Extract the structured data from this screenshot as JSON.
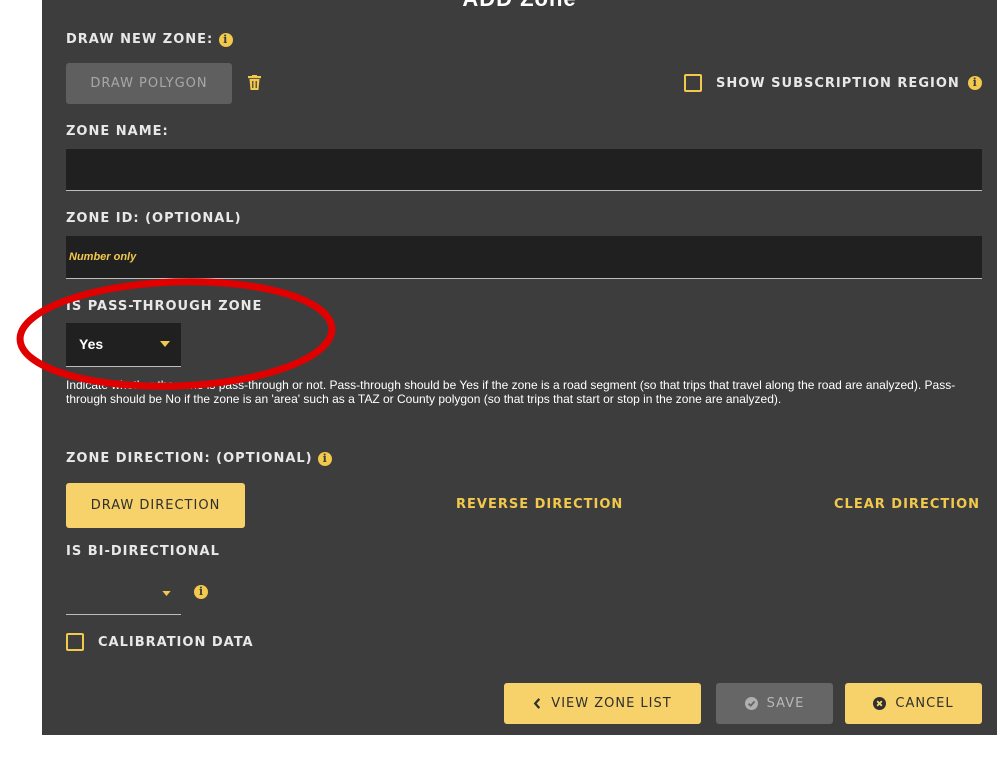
{
  "dialog": {
    "title": "ADD Zone"
  },
  "draw_zone": {
    "label": "DRAW NEW ZONE:",
    "draw_polygon_label": "DRAW POLYGON",
    "show_subscription_label": "SHOW SUBSCRIPTION REGION"
  },
  "zone_name": {
    "label": "ZONE NAME:",
    "value": ""
  },
  "zone_id": {
    "label": "ZONE ID: (OPTIONAL)",
    "placeholder": "Number only"
  },
  "pass_through": {
    "label": "IS PASS-THROUGH ZONE",
    "selected": "Yes",
    "help": "Indicate whether the zone is pass-through or not. Pass-through should be Yes if the zone is a road segment (so that trips that travel along the road are analyzed). Pass-through should be No if the zone is an 'area' such as a TAZ or County polygon (so that trips that start or stop in the zone are analyzed)."
  },
  "zone_direction": {
    "label": "ZONE DIRECTION: (OPTIONAL)",
    "draw_label": "DRAW DIRECTION",
    "reverse_label": "REVERSE DIRECTION",
    "clear_label": "CLEAR DIRECTION"
  },
  "bi_directional": {
    "label": "IS BI-DIRECTIONAL",
    "selected": ""
  },
  "calibration": {
    "label": "CALIBRATION DATA"
  },
  "footer": {
    "view_list_label": "VIEW ZONE LIST",
    "save_label": "SAVE",
    "cancel_label": "CANCEL"
  },
  "colors": {
    "panel_bg": "#3d3d3d",
    "accent": "#f2c94c",
    "button_yellow": "#f7d26a",
    "annotation_red": "#e00000"
  },
  "icons": [
    "info-icon",
    "trash-icon",
    "caret-down-icon",
    "chevron-left-icon",
    "check-circle-icon",
    "times-circle-icon"
  ]
}
